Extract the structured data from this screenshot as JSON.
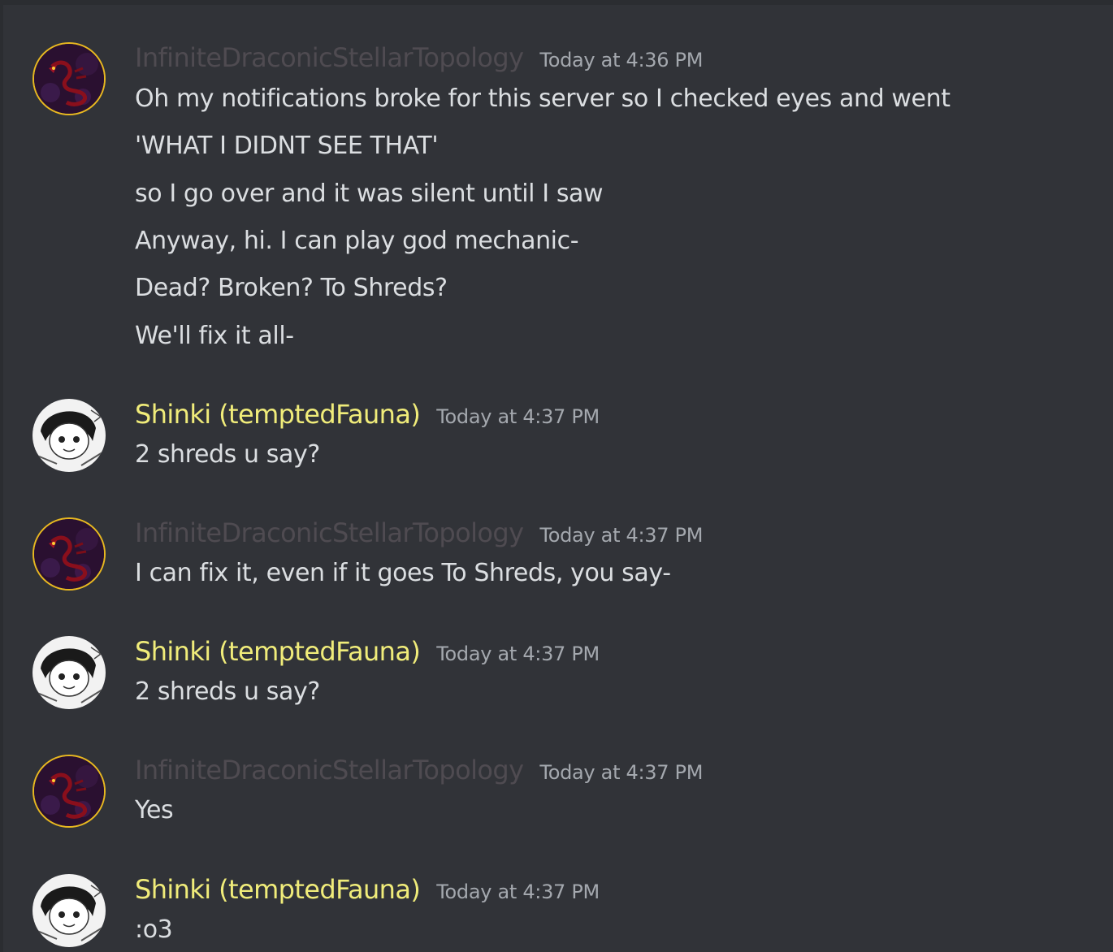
{
  "messages": [
    {
      "author": "InfiniteDraconicStellarTopology",
      "avatar": "dragon-avatar-icon",
      "timestamp": "Today at 4:36 PM",
      "lines": [
        "Oh my notifications broke for this server so I checked eyes and went",
        "'WHAT I DIDNT SEE THAT'",
        "so I go over and it was silent until I saw",
        "Anyway, hi. I can play god mechanic-",
        "Dead? Broken? To Shreds?",
        "We'll fix it all-"
      ]
    },
    {
      "author": "Shinki (temptedFauna)",
      "avatar": "shinki-avatar-icon",
      "timestamp": "Today at 4:37 PM",
      "lines": [
        "2 shreds u say?"
      ]
    },
    {
      "author": "InfiniteDraconicStellarTopology",
      "avatar": "dragon-avatar-icon",
      "timestamp": "Today at 4:37 PM",
      "lines": [
        "I can fix it, even if it goes To Shreds, you say-"
      ]
    },
    {
      "author": "Shinki (temptedFauna)",
      "avatar": "shinki-avatar-icon",
      "timestamp": "Today at 4:37 PM",
      "lines": [
        "2 shreds u say?"
      ]
    },
    {
      "author": "InfiniteDraconicStellarTopology",
      "avatar": "dragon-avatar-icon",
      "timestamp": "Today at 4:37 PM",
      "lines": [
        "Yes"
      ]
    },
    {
      "author": "Shinki (temptedFauna)",
      "avatar": "shinki-avatar-icon",
      "timestamp": "Today at 4:37 PM",
      "lines": [
        ":o3"
      ]
    }
  ],
  "colors": {
    "background": "#313338",
    "idst_name": "#4f4b51",
    "shinki_name": "#f0ec7a",
    "timestamp": "#a4a8ae",
    "message_text": "#dbdee1",
    "dragon_avatar_ring": "#e8b820"
  }
}
